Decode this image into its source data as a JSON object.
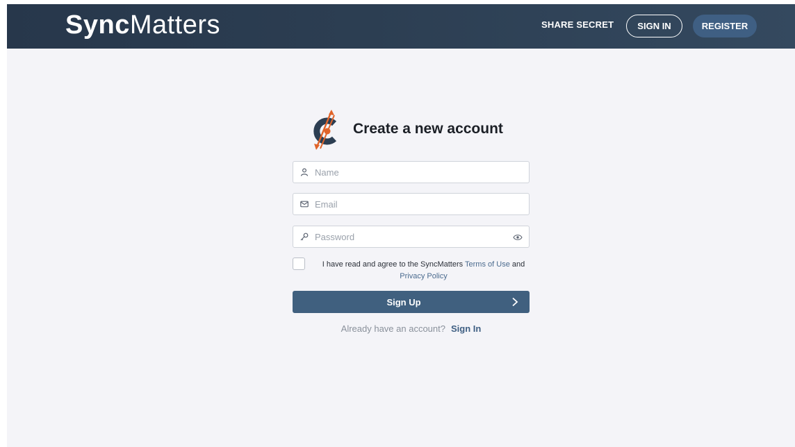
{
  "header": {
    "logo_left": "Sync",
    "logo_right": "Matters",
    "nav": {
      "share_secret": "SHARE SECRET",
      "sign_in": "SIGN IN",
      "register": "REGISTER"
    }
  },
  "form": {
    "title": "Create a new account",
    "name_placeholder": "Name",
    "email_placeholder": "Email",
    "password_placeholder": "Password",
    "agree_prefix": "I have read and agree to the SyncMatters",
    "terms_link": "Terms of Use",
    "agree_and": "and",
    "privacy_link": "Privacy Policy",
    "terms_checked": false,
    "submit_label": "Sign Up",
    "already_text": "Already have an account?",
    "signin_link": "Sign In"
  },
  "icons": {
    "name": "user-icon",
    "email": "envelope-icon",
    "password": "key-icon",
    "toggle": "eye-icon",
    "submit": "chevron-right-icon"
  },
  "colors": {
    "header_bg": "#2c3e52",
    "accent": "#40607f",
    "brand_orange": "#e0642a",
    "page_bg": "#f4f4f8",
    "link": "#4a6a8e"
  }
}
